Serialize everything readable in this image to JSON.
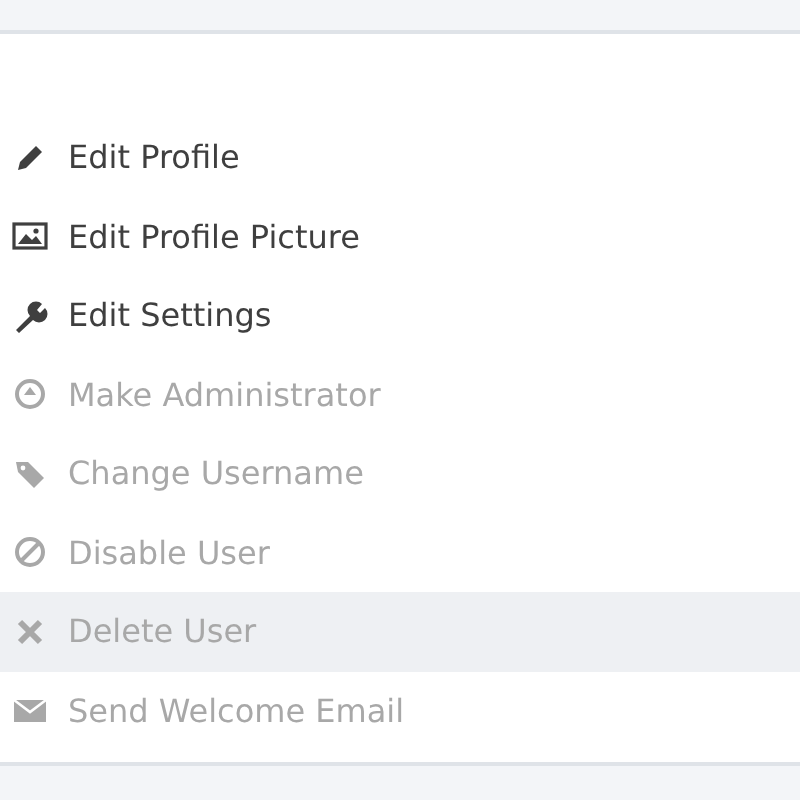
{
  "menu": {
    "items": [
      {
        "label": "Edit Profile",
        "disabled": false,
        "selected": false
      },
      {
        "label": "Edit Profile Picture",
        "disabled": false,
        "selected": false
      },
      {
        "label": "Edit Settings",
        "disabled": false,
        "selected": false
      },
      {
        "label": "Make Administrator",
        "disabled": true,
        "selected": false
      },
      {
        "label": "Change Username",
        "disabled": true,
        "selected": false
      },
      {
        "label": "Disable User",
        "disabled": true,
        "selected": false
      },
      {
        "label": "Delete User",
        "disabled": true,
        "selected": true
      },
      {
        "label": "Send Welcome Email",
        "disabled": true,
        "selected": false
      }
    ]
  }
}
